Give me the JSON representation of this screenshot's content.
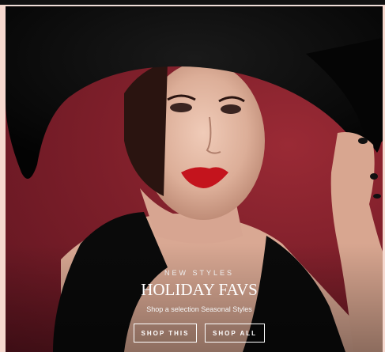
{
  "hero": {
    "eyebrow": "NEW STYLES",
    "title": "HOLIDAY FAVS",
    "subtitle": "Shop a selection Seasonal Styles",
    "buttons": {
      "shop_this": "SHOP THIS",
      "shop_all": "SHOP ALL"
    }
  },
  "colors": {
    "page_background": "#f6d9cf",
    "hero_background": "#8a2430",
    "hat": "#0b0b0b",
    "lip": "#c4141d",
    "text": "#ffffff"
  }
}
